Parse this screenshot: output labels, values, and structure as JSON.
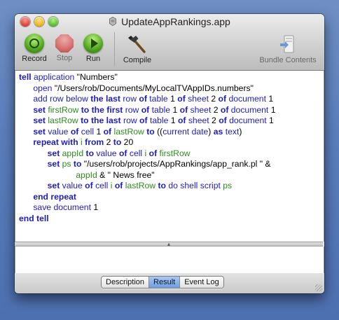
{
  "window": {
    "title": "UpdateAppRankings.app"
  },
  "toolbar": {
    "record_label": "Record",
    "stop_label": "Stop",
    "run_label": "Run",
    "compile_label": "Compile",
    "bundle_label": "Bundle Contents"
  },
  "script_lines": [
    [
      {
        "t": "tell ",
        "c": "kw"
      },
      {
        "t": "application ",
        "c": "app"
      },
      {
        "t": "\"Numbers\"",
        "c": "plain"
      }
    ],
    [
      {
        "t": "\topen ",
        "c": "app"
      },
      {
        "t": "\"/Users/rob/Documents/MyLocalTVAppIDs.numbers\"",
        "c": "plain"
      }
    ],
    [
      {
        "t": "\tadd row ",
        "c": "app"
      },
      {
        "t": "below ",
        "c": "app"
      },
      {
        "t": "the last ",
        "c": "kw"
      },
      {
        "t": "row ",
        "c": "app"
      },
      {
        "t": "of ",
        "c": "kw"
      },
      {
        "t": "table ",
        "c": "app"
      },
      {
        "t": "1 ",
        "c": "plain"
      },
      {
        "t": "of ",
        "c": "kw"
      },
      {
        "t": "sheet ",
        "c": "app"
      },
      {
        "t": "2 ",
        "c": "plain"
      },
      {
        "t": "of ",
        "c": "kw"
      },
      {
        "t": "document ",
        "c": "app"
      },
      {
        "t": "1",
        "c": "plain"
      }
    ],
    [
      {
        "t": "\tset ",
        "c": "kw"
      },
      {
        "t": "firstRow ",
        "c": "var"
      },
      {
        "t": "to the first ",
        "c": "kw"
      },
      {
        "t": "row ",
        "c": "app"
      },
      {
        "t": "of ",
        "c": "kw"
      },
      {
        "t": "table ",
        "c": "app"
      },
      {
        "t": "1 ",
        "c": "plain"
      },
      {
        "t": "of ",
        "c": "kw"
      },
      {
        "t": "sheet ",
        "c": "app"
      },
      {
        "t": "2 ",
        "c": "plain"
      },
      {
        "t": "of ",
        "c": "kw"
      },
      {
        "t": "document ",
        "c": "app"
      },
      {
        "t": "1",
        "c": "plain"
      }
    ],
    [
      {
        "t": "\tset ",
        "c": "kw"
      },
      {
        "t": "lastRow ",
        "c": "var"
      },
      {
        "t": "to the last ",
        "c": "kw"
      },
      {
        "t": "row ",
        "c": "app"
      },
      {
        "t": "of ",
        "c": "kw"
      },
      {
        "t": "table ",
        "c": "app"
      },
      {
        "t": "1 ",
        "c": "plain"
      },
      {
        "t": "of ",
        "c": "kw"
      },
      {
        "t": "sheet ",
        "c": "app"
      },
      {
        "t": "2 ",
        "c": "plain"
      },
      {
        "t": "of ",
        "c": "kw"
      },
      {
        "t": "document ",
        "c": "app"
      },
      {
        "t": "1",
        "c": "plain"
      }
    ],
    [
      {
        "t": "\tset ",
        "c": "kw"
      },
      {
        "t": "value ",
        "c": "app"
      },
      {
        "t": "of ",
        "c": "kw"
      },
      {
        "t": "cell ",
        "c": "app"
      },
      {
        "t": "1 ",
        "c": "plain"
      },
      {
        "t": "of ",
        "c": "kw"
      },
      {
        "t": "lastRow ",
        "c": "var"
      },
      {
        "t": "to ",
        "c": "kw"
      },
      {
        "t": "((",
        "c": "plain"
      },
      {
        "t": "current date",
        "c": "app"
      },
      {
        "t": ") ",
        "c": "plain"
      },
      {
        "t": "as ",
        "c": "kw"
      },
      {
        "t": "text",
        "c": "app"
      },
      {
        "t": ")",
        "c": "plain"
      }
    ],
    [
      {
        "t": "\trepeat with ",
        "c": "kw"
      },
      {
        "t": "i ",
        "c": "var"
      },
      {
        "t": "from ",
        "c": "kw"
      },
      {
        "t": "2 ",
        "c": "plain"
      },
      {
        "t": "to ",
        "c": "kw"
      },
      {
        "t": "20",
        "c": "plain"
      }
    ],
    [
      {
        "t": "\t\tset ",
        "c": "kw"
      },
      {
        "t": "appId ",
        "c": "var"
      },
      {
        "t": "to ",
        "c": "kw"
      },
      {
        "t": "value ",
        "c": "app"
      },
      {
        "t": "of ",
        "c": "kw"
      },
      {
        "t": "cell ",
        "c": "app"
      },
      {
        "t": "i ",
        "c": "var"
      },
      {
        "t": "of ",
        "c": "kw"
      },
      {
        "t": "firstRow",
        "c": "var"
      }
    ],
    [
      {
        "t": "\t\tset ",
        "c": "kw"
      },
      {
        "t": "ps ",
        "c": "var"
      },
      {
        "t": "to ",
        "c": "kw"
      },
      {
        "t": "\"/users/rob/projects/AppRankings/app_rank.pl \" &",
        "c": "plain"
      }
    ],
    [
      {
        "t": "\t\t\t\t",
        "c": "plain"
      },
      {
        "t": "appId ",
        "c": "var"
      },
      {
        "t": "& \" News free\"",
        "c": "plain"
      }
    ],
    [
      {
        "t": "\t\tset ",
        "c": "kw"
      },
      {
        "t": "value ",
        "c": "app"
      },
      {
        "t": "of ",
        "c": "kw"
      },
      {
        "t": "cell ",
        "c": "app"
      },
      {
        "t": "i ",
        "c": "var"
      },
      {
        "t": "of ",
        "c": "kw"
      },
      {
        "t": "lastRow ",
        "c": "var"
      },
      {
        "t": "to ",
        "c": "kw"
      },
      {
        "t": "do shell script ",
        "c": "app"
      },
      {
        "t": "ps",
        "c": "var"
      }
    ],
    [
      {
        "t": "\tend repeat",
        "c": "kw"
      }
    ],
    [
      {
        "t": "\tsave ",
        "c": "app"
      },
      {
        "t": "document ",
        "c": "app"
      },
      {
        "t": "1",
        "c": "plain"
      }
    ],
    [
      {
        "t": "end tell",
        "c": "kw"
      }
    ]
  ],
  "tabs": {
    "description": "Description",
    "result": "Result",
    "event_log": "Event Log",
    "active": "Result"
  },
  "colors": {
    "keyword": "#1d1cbf",
    "variable": "#2d8a1f",
    "selected_tab": "#6e9ee0"
  }
}
